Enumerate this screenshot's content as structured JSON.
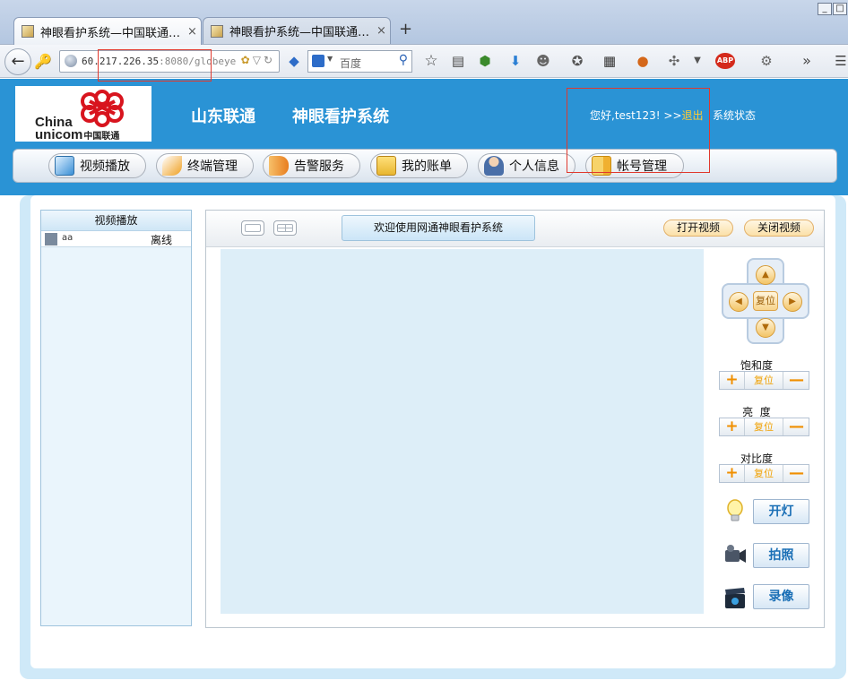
{
  "browser": {
    "tabs": [
      {
        "title": "神眼看护系统—中国联通…",
        "close": "×"
      },
      {
        "title": "神眼看护系统—中国联通…",
        "close": "×"
      }
    ],
    "new_tab": "+",
    "url": {
      "host": "60.217.226.35",
      "port": ":8080",
      "path": "/globeye"
    },
    "search_placeholder": "百度",
    "toolbar_icons": [
      "bookmark-star-icon",
      "reading-list-icon",
      "shield-addon-icon",
      "download-arrow-icon",
      "smiley-addon-icon",
      "palette-addon-icon",
      "qr-code-icon",
      "fox-addon-icon",
      "tools-addon-icon",
      "adblock-plus-icon",
      "gear-addon-icon",
      "overflow-chevron-icon",
      "hamburger-menu-icon"
    ],
    "adblock_label": "ABP",
    "overflow": "»",
    "window": {
      "minimize": "_",
      "maximize": "□"
    }
  },
  "header": {
    "logo_en_line1": "China",
    "logo_en_line2": "unicom",
    "logo_cn": "中国联通",
    "region": "山东联通",
    "system_name": "神眼看护系统",
    "greeting_prefix": "您好,test123! >>",
    "logout": "退出",
    "system_status": "系统状态"
  },
  "menu": [
    {
      "label": "视频播放",
      "icon": "video-play-icon",
      "color": "#3a8fd6"
    },
    {
      "label": "终端管理",
      "icon": "wrench-icon",
      "color": "#f0a020"
    },
    {
      "label": "告警服务",
      "icon": "megaphone-icon",
      "color": "#e87d1e"
    },
    {
      "label": "我的账单",
      "icon": "bill-box-icon",
      "color": "#e8b630"
    },
    {
      "label": "个人信息",
      "icon": "user-profile-icon",
      "color": "#4a6fa8"
    },
    {
      "label": "帐号管理",
      "icon": "account-book-icon",
      "color": "#f0b030"
    }
  ],
  "sidebar": {
    "title": "视频播放",
    "devices": [
      {
        "name": "aa",
        "status": "离线"
      }
    ]
  },
  "main": {
    "welcome": "欢迎使用网通神眼看护系统",
    "open_video": "打开视频",
    "close_video": "关闭视频",
    "ptz_reset": "复位",
    "ptz_up": "▲",
    "ptz_down": "▼",
    "ptz_left": "◀",
    "ptz_right": "▶",
    "adjustments": [
      {
        "label": "饱和度",
        "plus": "+",
        "reset": "复位",
        "minus": "—"
      },
      {
        "label": "亮  度",
        "plus": "+",
        "reset": "复位",
        "minus": "—"
      },
      {
        "label": "对比度",
        "plus": "+",
        "reset": "复位",
        "minus": "—"
      }
    ],
    "actions": [
      {
        "label": "开灯",
        "icon": "light-bulb-icon"
      },
      {
        "label": "拍照",
        "icon": "camera-icon"
      },
      {
        "label": "录像",
        "icon": "film-clapper-icon"
      }
    ]
  }
}
